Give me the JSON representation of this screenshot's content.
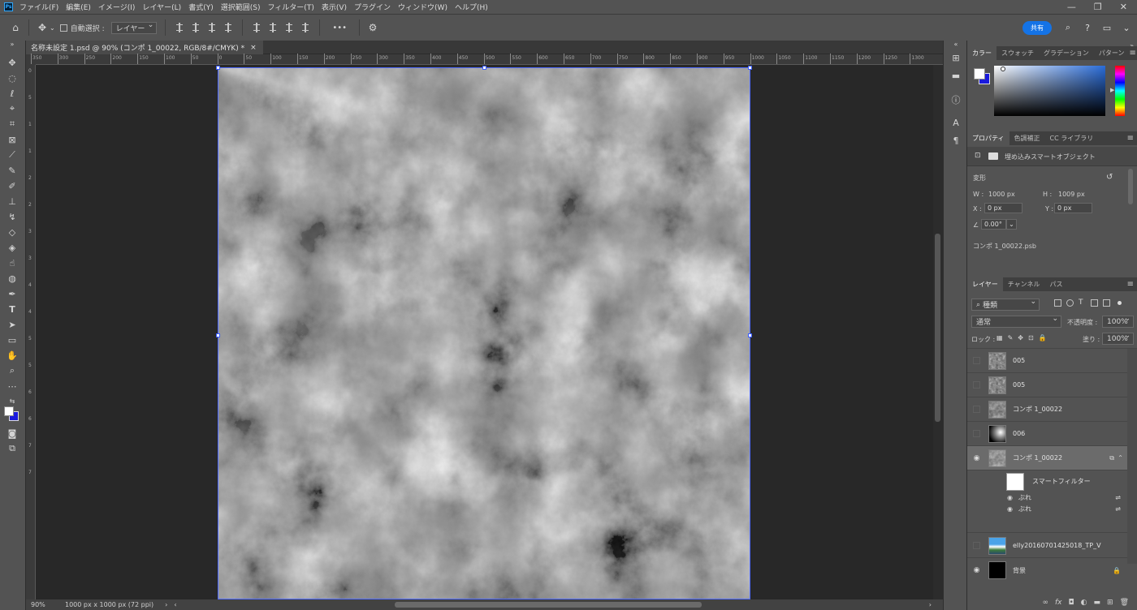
{
  "app": {
    "logo": "Ps",
    "doc_tab_title": "名称未設定 1.psd @ 90% (コンポ 1_00022, RGB/8#/CMYK) *",
    "zoom": "90%",
    "doc_size": "1000 px x 1000 px (72 ppi)"
  },
  "menu": [
    "ファイル(F)",
    "編集(E)",
    "イメージ(I)",
    "レイヤー(L)",
    "書式(Y)",
    "選択範囲(S)",
    "フィルター(T)",
    "表示(V)",
    "プラグイン",
    "ウィンドウ(W)",
    "ヘルプ(H)"
  ],
  "window_controls": {
    "minimize": "—",
    "restore": "❐",
    "close": "✕"
  },
  "options": {
    "auto_select_label": "自動選択 :",
    "auto_select_target": "レイヤー",
    "more": "•••",
    "share": "共有"
  },
  "ruler_h_labels": [
    "350",
    "300",
    "250",
    "200",
    "150",
    "100",
    "50",
    "0",
    "50",
    "100",
    "150",
    "200",
    "250",
    "300",
    "350",
    "400",
    "450",
    "500",
    "550",
    "600",
    "650",
    "700",
    "750",
    "800",
    "850",
    "900",
    "950",
    "1000",
    "1050",
    "1100",
    "1150",
    "1200",
    "1250",
    "1300"
  ],
  "ruler_v_labels": [
    "0",
    "5",
    "1",
    "1",
    "2",
    "2",
    "3",
    "3",
    "4",
    "4",
    "5",
    "5",
    "6",
    "6",
    "7",
    "7"
  ],
  "color_panel": {
    "tabs": [
      "カラー",
      "スウォッチ",
      "グラデーション",
      "パターン"
    ],
    "fg": "#ffffff",
    "bg": "#1a1adc"
  },
  "properties_panel": {
    "tabs": [
      "プロパティ",
      "色調補正",
      "CC ライブラリ"
    ],
    "object_type": "埋め込みスマートオブジェクト",
    "section": "変形",
    "w_label": "W :",
    "w": "1000 px",
    "h_label": "H :",
    "h": "1009 px",
    "x_label": "X :",
    "x": "0 px",
    "y_label": "Y :",
    "y": "0 px",
    "angle": "0.00°",
    "file": "コンポ 1_00022.psb"
  },
  "layers_panel": {
    "tabs": [
      "レイヤー",
      "チャンネル",
      "パス"
    ],
    "filter": "種類",
    "blend": "通常",
    "opacity_label": "不透明度 :",
    "opacity": "100%",
    "lock_label": "ロック :",
    "fill_label": "塗り :",
    "fill": "100%",
    "layers": [
      {
        "name": "005",
        "visible": false,
        "thumb": "noise"
      },
      {
        "name": "005",
        "visible": false,
        "thumb": "noise"
      },
      {
        "name": "コンポ 1_00022",
        "visible": false,
        "thumb": "cloud"
      },
      {
        "name": "006",
        "visible": false,
        "thumb": "gradient"
      },
      {
        "name": "コンポ 1_00022",
        "visible": true,
        "thumb": "cloud",
        "active": true
      },
      {
        "name": "elly20160701425018_TP_V",
        "visible": false,
        "thumb": "photo"
      },
      {
        "name": "背景",
        "visible": true,
        "thumb": "black",
        "locked": true
      }
    ],
    "smart_filter": "スマートフィルター",
    "filters": [
      "ぶれ",
      "ぶれ"
    ],
    "bottom_icons": [
      "link",
      "fx",
      "mask",
      "adjust",
      "folder",
      "new",
      "trash"
    ]
  }
}
